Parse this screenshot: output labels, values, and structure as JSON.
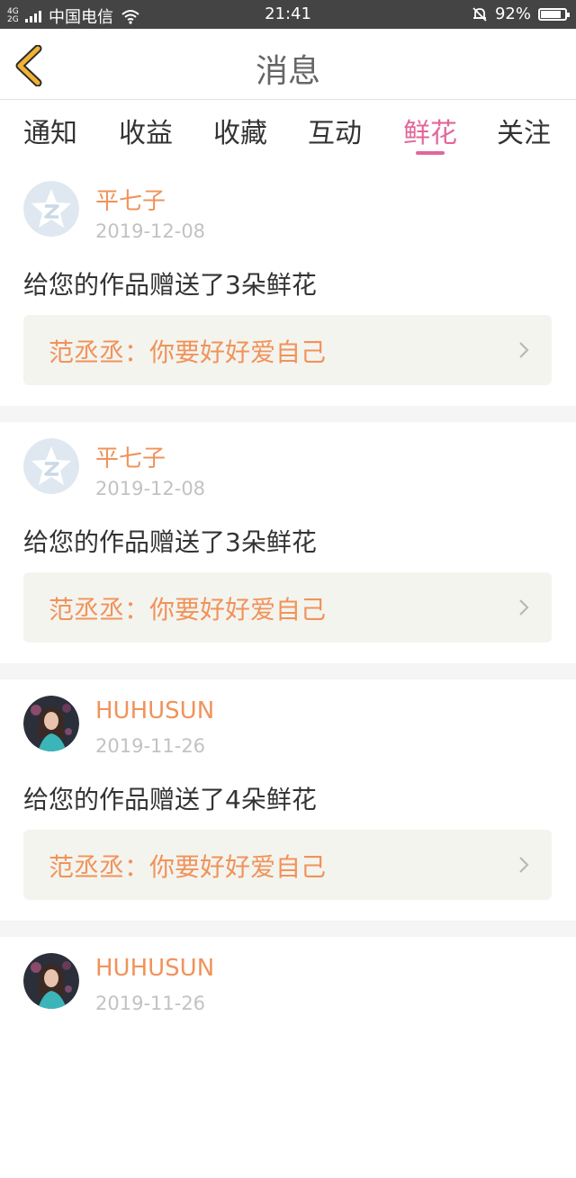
{
  "status_bar": {
    "network": "4G 2G",
    "carrier": "中国电信",
    "time": "21:41",
    "battery": "92%",
    "battery_level": 0.92
  },
  "header": {
    "title": "消息",
    "back_icon": "chevron-left-icon",
    "accent": "#f2b233"
  },
  "tabs": [
    {
      "label": "通知",
      "active": false
    },
    {
      "label": "收益",
      "active": false
    },
    {
      "label": "收藏",
      "active": false
    },
    {
      "label": "互动",
      "active": false
    },
    {
      "label": "鲜花",
      "active": true
    },
    {
      "label": "关注",
      "active": false
    }
  ],
  "colors": {
    "active_tab": "#e2679a",
    "username": "#f0935a",
    "quote": "#f0935a",
    "date": "#c2c2c2"
  },
  "messages": [
    {
      "username": "平七子",
      "date": "2019-12-08",
      "text": "给您的作品赠送了3朵鲜花",
      "quote": "范丞丞：你要好好爱自己",
      "avatar": "default-qzone-avatar"
    },
    {
      "username": "平七子",
      "date": "2019-12-08",
      "text": "给您的作品赠送了3朵鲜花",
      "quote": "范丞丞：你要好好爱自己",
      "avatar": "default-qzone-avatar"
    },
    {
      "username": "HUHUSUN",
      "date": "2019-11-26",
      "text": "给您的作品赠送了4朵鲜花",
      "quote": "范丞丞：你要好好爱自己",
      "avatar": "photo-avatar"
    },
    {
      "username": "HUHUSUN",
      "date": "2019-11-26",
      "text": "",
      "quote": "",
      "avatar": "photo-avatar"
    }
  ]
}
